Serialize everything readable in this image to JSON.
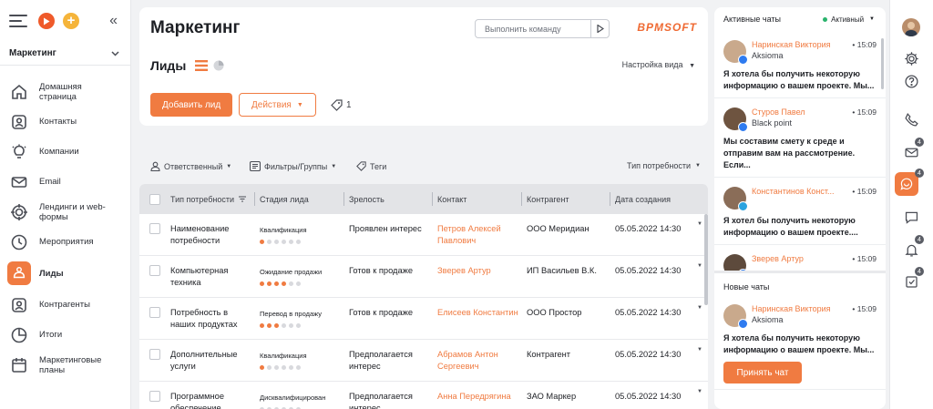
{
  "sidebar": {
    "workspace": "Маркетинг",
    "items": [
      {
        "label": "Домашняя страница",
        "icon": "home-icon"
      },
      {
        "label": "Контакты",
        "icon": "contact-icon"
      },
      {
        "label": "Компании",
        "icon": "lightbulb-icon"
      },
      {
        "label": "Email",
        "icon": "mail-icon"
      },
      {
        "label": "Лендинги и web-формы",
        "icon": "target-icon"
      },
      {
        "label": "Мероприятия",
        "icon": "clock-icon"
      },
      {
        "label": "Лиды",
        "icon": "leads-icon"
      },
      {
        "label": "Контрагенты",
        "icon": "contact-icon"
      },
      {
        "label": "Итоги",
        "icon": "pie-icon"
      },
      {
        "label": "Маркетинговые планы",
        "icon": "calendar-icon"
      }
    ]
  },
  "header": {
    "title": "Маркетинг",
    "command_placeholder": "Выполнить команду",
    "brand": "BPMSOFT"
  },
  "section": {
    "title": "Лиды",
    "view_settings": "Настройка вида",
    "add_button": "Добавить лид",
    "actions_button": "Действия",
    "tag_count": "1"
  },
  "filters": {
    "responsible": "Ответственный",
    "filters_groups": "Фильтры/Группы",
    "tags": "Теги",
    "need_type": "Тип потребности"
  },
  "grid": {
    "columns": [
      "Тип потребности",
      "Стадия лида",
      "Зрелость",
      "Контакт",
      "Контрагент",
      "Дата создания"
    ],
    "rows": [
      {
        "need": "Наименование потребности",
        "stage": "Квалификация",
        "progress": 1,
        "maturity": "Проявлен интерес",
        "contact": "Петров Алексей Павлович",
        "account": "ООО Меридиан",
        "date": "05.05.2022  14:30"
      },
      {
        "need": "Компьютерная техника",
        "stage": "Ожидание продажи",
        "progress": 4,
        "maturity": "Готов к продаже",
        "contact": "Зверев Артур",
        "account": "ИП Васильев В.К.",
        "date": "05.05.2022  14:30"
      },
      {
        "need": "Потребность в наших продуктах",
        "stage": "Перевод в продажу",
        "progress": 3,
        "maturity": "Готов к продаже",
        "contact": "Елисеев Константин",
        "account": "ООО Простор",
        "date": "05.05.2022  14:30"
      },
      {
        "need": "Дополнительные услуги",
        "stage": "Квалификация",
        "progress": 1,
        "maturity": "Предполагается интерес",
        "contact": "Абрамов Антон Сергеевич",
        "account": "Контрагент",
        "date": "05.05.2022  14:30"
      },
      {
        "need": "Программное обеспечение",
        "stage": "Дисквалифицирован",
        "progress": 0,
        "maturity": "Предполагается интерес",
        "contact": "Анна Передрягина",
        "account": "ЗАО Маркер",
        "date": "05.05.2022  14:30"
      }
    ],
    "dots_total": 6
  },
  "chats": {
    "title": "Активные чаты",
    "status": "Активный",
    "active": [
      {
        "name": "Наринская Виктория",
        "org": "Aksioma",
        "time": "• 15:09",
        "msg": "Я хотела бы получить некоторую информацию о вашем проекте. Мы...",
        "avatar_color": "#c9a98c",
        "channel_color": "#2e7bf0"
      },
      {
        "name": "Стуров Павел",
        "org": "Black point",
        "time": "• 15:09",
        "msg": "Мы составим смету к среде и отправим вам на рассмотрение. Если...",
        "avatar_color": "#6e5440",
        "channel_color": "#2e7bf0"
      },
      {
        "name": "Константинов Конст...",
        "org": "",
        "time": "• 15:09",
        "msg": "Я хотел бы получить некоторую информацию о вашем проекте....",
        "avatar_color": "#8a6d58",
        "channel_color": "#2aa3e0"
      },
      {
        "name": "Зверев Артур",
        "org": "",
        "time": "• 15:09",
        "msg": "",
        "avatar_color": "#5d4a3c",
        "channel_color": "#2e7bf0"
      }
    ],
    "new_title": "Новые чаты",
    "new": [
      {
        "name": "Наринская Виктория",
        "org": "Aksioma",
        "time": "• 15:09",
        "msg": "Я хотела бы получить некоторую информацию о вашем проекте. Мы...",
        "avatar_color": "#c9a98c",
        "channel_color": "#2e7bf0"
      }
    ],
    "accept_button": "Принять чат"
  },
  "rail": {
    "badges": {
      "mail": "4",
      "chat": "4",
      "notify": "4",
      "tasks": "4"
    }
  },
  "colors": {
    "accent": "#f07b41",
    "brand": "#ef6a33"
  }
}
